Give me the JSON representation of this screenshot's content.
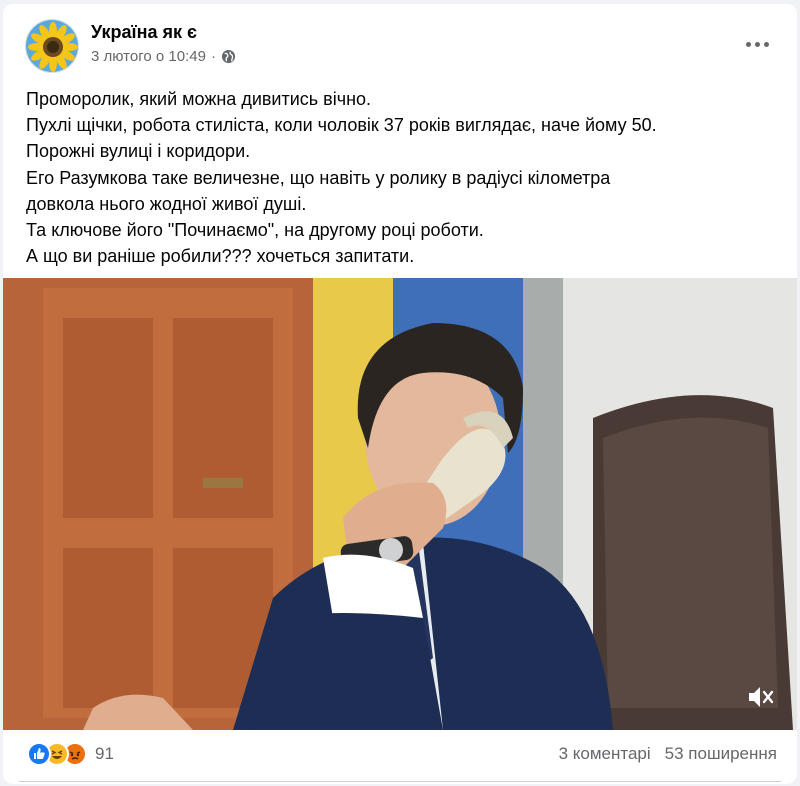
{
  "post": {
    "page_name": "Україна як є",
    "date": "3 лютого о 10:49",
    "separator": "·",
    "privacy_icon": "globe-icon",
    "more_icon": "more-options-icon",
    "text_lines": [
      "Проморолик, який можна дивитись вічно.",
      "Пухлі щічки, робота стиліста, коли чоловік 37 років виглядає, наче йому 50.",
      "Порожні вулиці і коридори.",
      "Его Разумкова таке величезне, що навіть у ролику в радіусі кілометра",
      "довкола нього  жодної живої душі.",
      "Та ключове його \"Починаємо\", на другому році роботи.",
      "А що ви раніше робили??? хочеться запитати."
    ]
  },
  "video": {
    "mute_icon": "speaker-muted-icon"
  },
  "footer": {
    "reaction_icons": [
      "like-icon",
      "haha-icon",
      "angry-icon"
    ],
    "reaction_count": "91",
    "comments": "3 коментарі",
    "shares": "53 поширення"
  },
  "colors": {
    "like": "#1877f2",
    "haha": "#f7b928",
    "angry": "#e9710f",
    "secondary_text": "#65676b"
  }
}
